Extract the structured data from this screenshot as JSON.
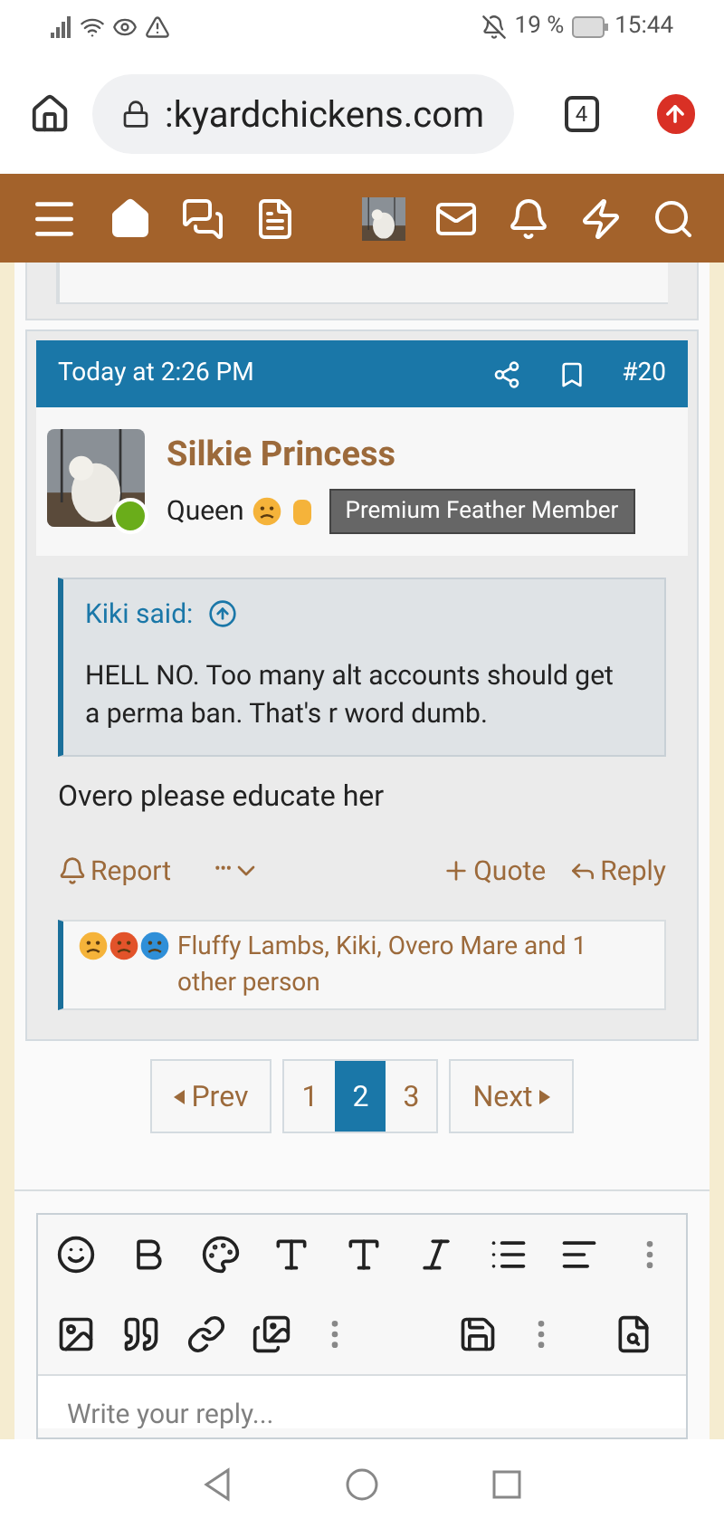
{
  "status_bar": {
    "battery": "19 %",
    "time": "15:44"
  },
  "browser": {
    "url": ":kyardchickens.com",
    "tab_count": "4"
  },
  "post": {
    "time": "Today at 2:26 PM",
    "number": "#20",
    "author": "Silkie Princess",
    "author_title": "Queen",
    "badge": "Premium Feather Member",
    "online": true,
    "quote": {
      "author": "Kiki said:",
      "text": "HELL NO. Too many alt accounts should get a perma ban. That's r word dumb."
    },
    "message": "Overo please educate her",
    "actions": [
      {
        "kind": "report",
        "label": "Report"
      },
      {
        "kind": "more",
        "label": "•••"
      },
      {
        "kind": "quote",
        "label": "Quote"
      },
      {
        "kind": "reply",
        "label": "Reply"
      }
    ],
    "reactions": "Fluffy Lambs, Kiki, Overo Mare and 1 other person"
  },
  "pagination": {
    "prev": "Prev",
    "next": "Next",
    "pages": [
      {
        "label": "1",
        "selected": false
      },
      {
        "label": "2",
        "selected": true
      },
      {
        "label": "3",
        "selected": false
      }
    ]
  },
  "editor": {
    "placeholder": "Write your reply..."
  }
}
